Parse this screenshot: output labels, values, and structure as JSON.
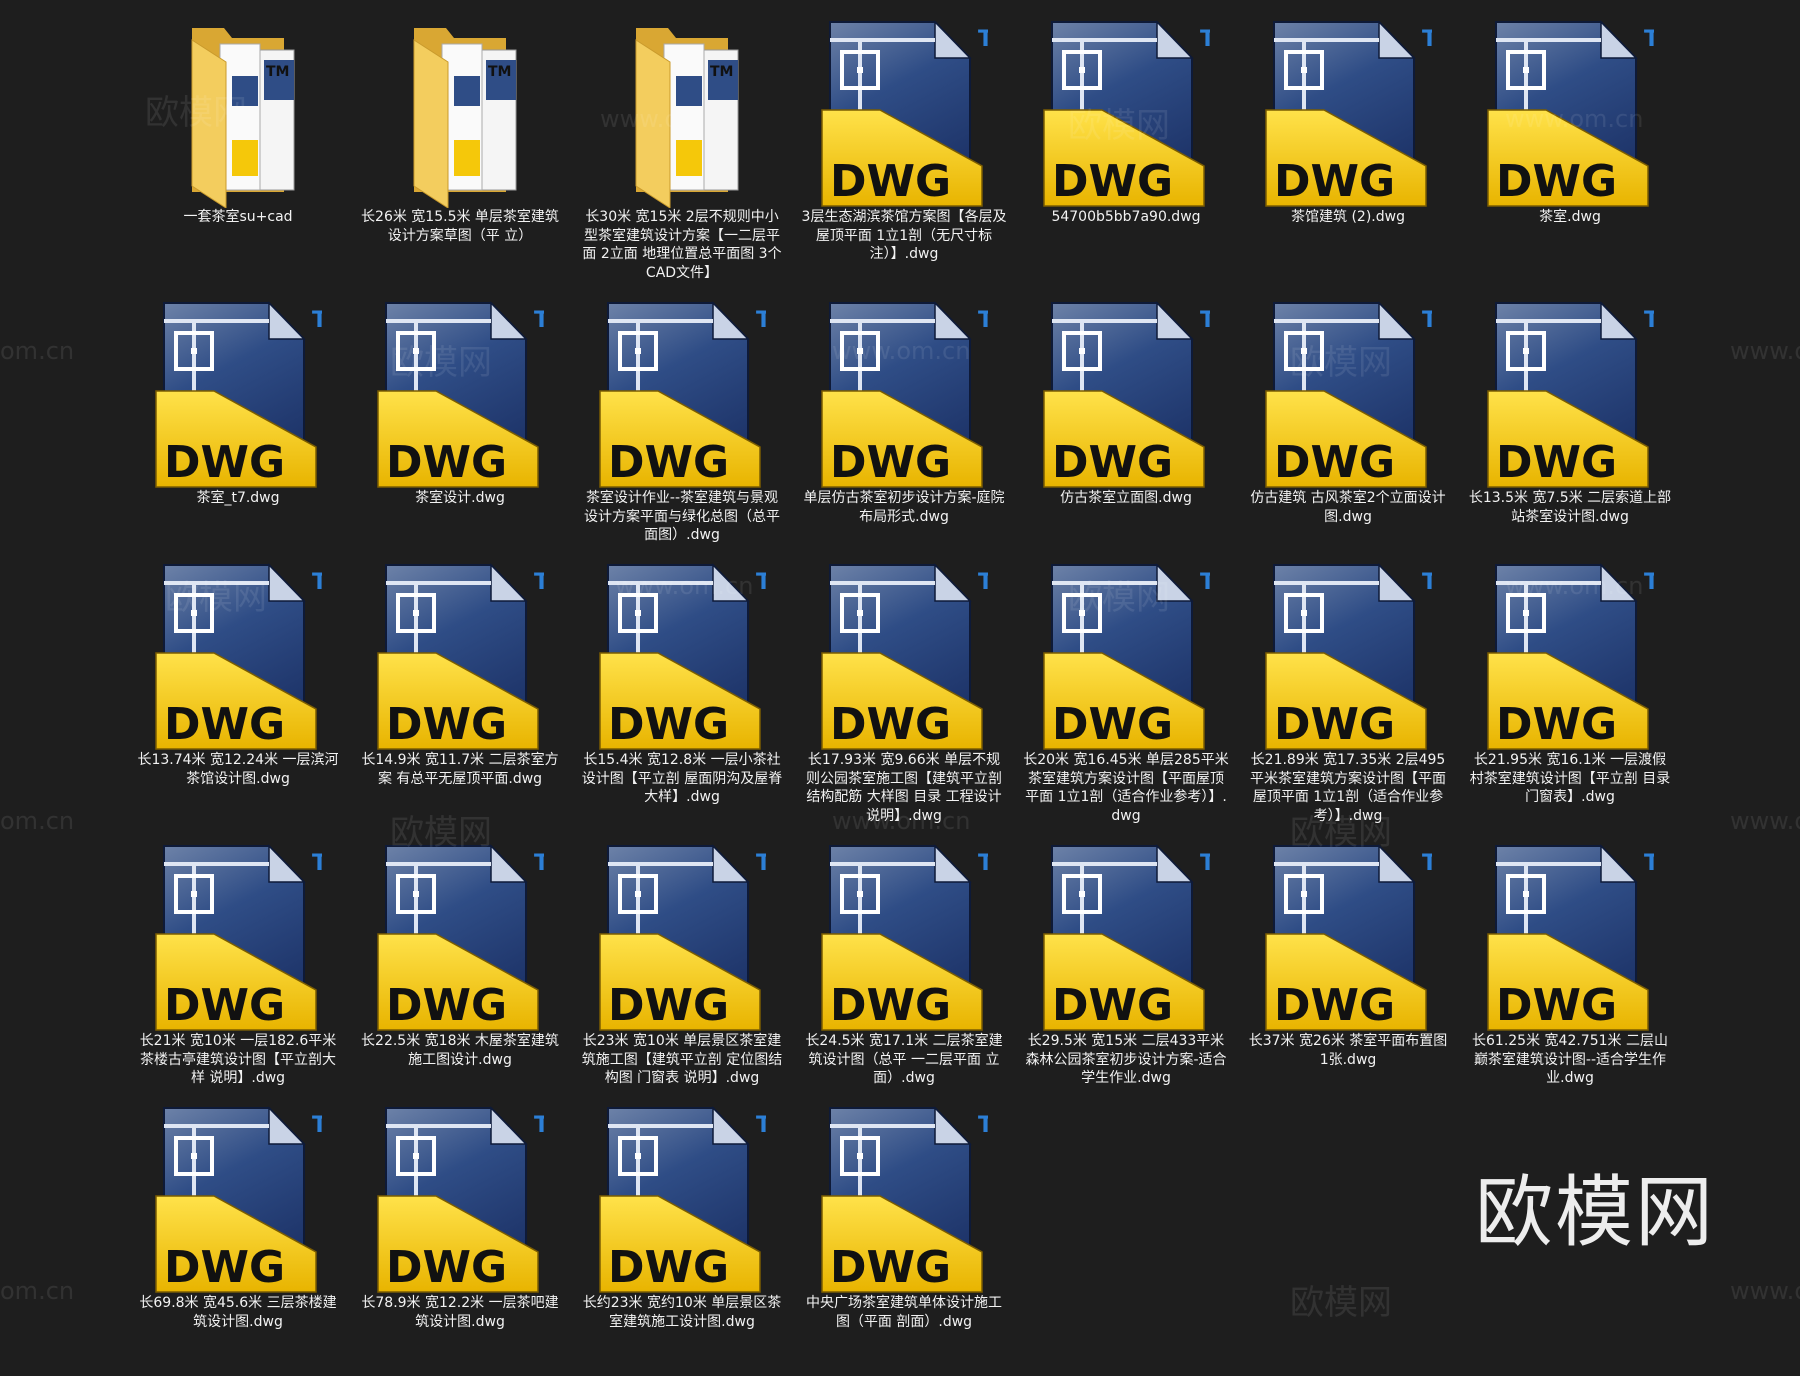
{
  "files": [
    {
      "type": "folder",
      "name": "一套茶室su+cad"
    },
    {
      "type": "folder",
      "name": "长26米 宽15.5米 单层茶室建筑设计方案草图（平 立）"
    },
    {
      "type": "folder",
      "name": "长30米 宽15米 2层不规则中小型茶室建筑设计方案【一二层平面 2立面 地理位置总平面图 3个CAD文件】"
    },
    {
      "type": "dwg",
      "name": "3层生态湖滨茶馆方案图【各层及屋顶平面 1立1剖（无尺寸标注）】.dwg"
    },
    {
      "type": "dwg",
      "name": "54700b5bb7a90.dwg"
    },
    {
      "type": "dwg",
      "name": "茶馆建筑 (2).dwg"
    },
    {
      "type": "dwg",
      "name": "茶室.dwg"
    },
    {
      "type": "dwg",
      "name": "茶室_t7.dwg"
    },
    {
      "type": "dwg",
      "name": "茶室设计.dwg"
    },
    {
      "type": "dwg",
      "name": "茶室设计作业--茶室建筑与景观设计方案平面与绿化总图（总平面图）.dwg"
    },
    {
      "type": "dwg",
      "name": "单层仿古茶室初步设计方案-庭院布局形式.dwg"
    },
    {
      "type": "dwg",
      "name": "仿古茶室立面图.dwg"
    },
    {
      "type": "dwg",
      "name": "仿古建筑 古风茶室2个立面设计图.dwg"
    },
    {
      "type": "dwg",
      "name": "长13.5米 宽7.5米 二层索道上部站茶室设计图.dwg"
    },
    {
      "type": "dwg",
      "name": "长13.74米 宽12.24米 一层滨河茶馆设计图.dwg"
    },
    {
      "type": "dwg",
      "name": "长14.9米 宽11.7米 二层茶室方案 有总平无屋顶平面.dwg"
    },
    {
      "type": "dwg",
      "name": "长15.4米 宽12.8米 一层小茶社设计图【平立剖 屋面阴沟及屋脊大样】.dwg"
    },
    {
      "type": "dwg",
      "name": "长17.93米 宽9.66米 单层不规则公园茶室施工图【建筑平立剖结构配筋 大样图 目录 工程设计说明】.dwg"
    },
    {
      "type": "dwg",
      "name": "长20米 宽16.45米 单层285平米茶室建筑方案设计图【平面屋顶平面 1立1剖（适合作业参考）】.dwg"
    },
    {
      "type": "dwg",
      "name": "长21.89米 宽17.35米 2层495平米茶室建筑方案设计图【平面屋顶平面 1立1剖（适合作业参考）】.dwg"
    },
    {
      "type": "dwg",
      "name": "长21.95米 宽16.1米 一层渡假村茶室建筑设计图【平立剖 目录 门窗表】.dwg"
    },
    {
      "type": "dwg",
      "name": "长21米 宽10米 一层182.6平米茶楼古亭建筑设计图【平立剖大样 说明】.dwg"
    },
    {
      "type": "dwg",
      "name": "长22.5米 宽18米 木屋茶室建筑施工图设计.dwg"
    },
    {
      "type": "dwg",
      "name": "长23米 宽10米 单层景区茶室建筑施工图【建筑平立剖 定位图结构图 门窗表 说明】.dwg"
    },
    {
      "type": "dwg",
      "name": "长24.5米 宽17.1米 二层茶室建筑设计图（总平 一二层平面 立面）.dwg"
    },
    {
      "type": "dwg",
      "name": "长29.5米 宽15米 二层433平米森林公园茶室初步设计方案-适合学生作业.dwg"
    },
    {
      "type": "dwg",
      "name": "长37米 宽26米 茶室平面布置图1张.dwg"
    },
    {
      "type": "dwg",
      "name": "长61.25米 宽42.751米 二层山巅茶室建筑设计图--适合学生作业.dwg"
    },
    {
      "type": "dwg",
      "name": "长69.8米 宽45.6米 三层茶楼建筑设计图.dwg"
    },
    {
      "type": "dwg",
      "name": "长78.9米 宽12.2米 一层茶吧建筑设计图.dwg"
    },
    {
      "type": "dwg",
      "name": "长约23米 宽约10米 单层景区茶室建筑施工设计图.dwg"
    },
    {
      "type": "dwg",
      "name": "中央广场茶室建筑单体设计施工图（平面 剖面）.dwg"
    }
  ],
  "icon_text": {
    "dwg_label": "DWG",
    "trademark": "TM"
  },
  "watermark": {
    "cn": "欧模网",
    "url": "www.om.cn",
    "url_fragment": "om.cn"
  },
  "brand": "欧模网",
  "colors": {
    "background": "#1e1e1e",
    "dwg_yellow": "#f5c80a",
    "dwg_blue": "#2f4d86",
    "folder_yellow": "#f1c64f",
    "tm_blue": "#2c7fd6"
  }
}
